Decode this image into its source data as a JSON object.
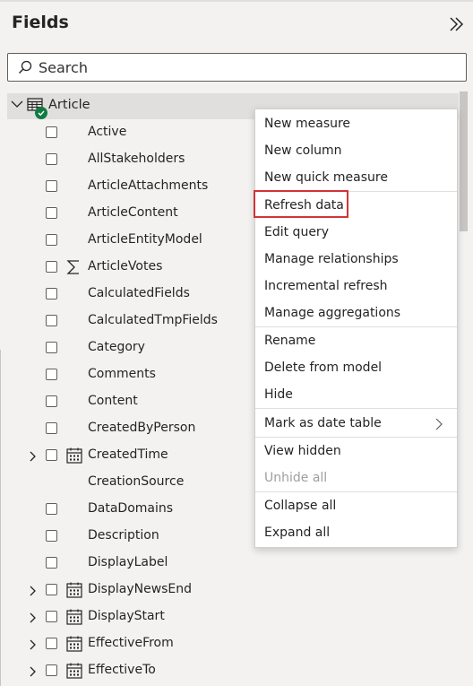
{
  "pane": {
    "title": "Fields",
    "collapse_icon": "double-chevron-right-icon"
  },
  "search": {
    "placeholder": "Search",
    "value": ""
  },
  "table": {
    "name": "Article",
    "expanded": true,
    "icon": "table-icon",
    "badge": "check-badge-icon"
  },
  "fields": [
    {
      "label": "Active",
      "icon": "",
      "expandable": false
    },
    {
      "label": "AllStakeholders",
      "icon": "",
      "expandable": false
    },
    {
      "label": "ArticleAttachments",
      "icon": "",
      "expandable": false
    },
    {
      "label": "ArticleContent",
      "icon": "",
      "expandable": false
    },
    {
      "label": "ArticleEntityModel",
      "icon": "",
      "expandable": false
    },
    {
      "label": "ArticleVotes",
      "icon": "sigma-icon",
      "expandable": false
    },
    {
      "label": "CalculatedFields",
      "icon": "",
      "expandable": false
    },
    {
      "label": "CalculatedTmpFields",
      "icon": "",
      "expandable": false
    },
    {
      "label": "Category",
      "icon": "",
      "expandable": false
    },
    {
      "label": "Comments",
      "icon": "",
      "expandable": false
    },
    {
      "label": "Content",
      "icon": "",
      "expandable": false
    },
    {
      "label": "CreatedByPerson",
      "icon": "",
      "expandable": false
    },
    {
      "label": "CreatedTime",
      "icon": "calendar-icon",
      "expandable": true
    },
    {
      "label": "CreationSource",
      "icon": "",
      "expandable": false
    },
    {
      "label": "DataDomains",
      "icon": "",
      "expandable": false
    },
    {
      "label": "Description",
      "icon": "",
      "expandable": false
    },
    {
      "label": "DisplayLabel",
      "icon": "",
      "expandable": false
    },
    {
      "label": "DisplayNewsEnd",
      "icon": "calendar-icon",
      "expandable": true
    },
    {
      "label": "DisplayStart",
      "icon": "calendar-icon",
      "expandable": true
    },
    {
      "label": "EffectiveFrom",
      "icon": "calendar-icon",
      "expandable": true
    },
    {
      "label": "EffectiveTo",
      "icon": "calendar-icon",
      "expandable": true
    }
  ],
  "context_menu": {
    "items": [
      {
        "label": "New measure"
      },
      {
        "label": "New column"
      },
      {
        "label": "New quick measure"
      },
      {
        "label": "Refresh data",
        "highlighted": true
      },
      {
        "label": "Edit query"
      },
      {
        "label": "Manage relationships"
      },
      {
        "label": "Incremental refresh"
      },
      {
        "label": "Manage aggregations"
      },
      {
        "label": "Rename"
      },
      {
        "label": "Delete from model"
      },
      {
        "label": "Hide"
      },
      {
        "label": "Mark as date table",
        "submenu": true
      },
      {
        "label": "View hidden"
      },
      {
        "label": "Unhide all",
        "disabled": true
      },
      {
        "label": "Collapse all"
      },
      {
        "label": "Expand all"
      }
    ]
  },
  "colors": {
    "highlight_border": "#d13438",
    "badge_green": "#107c41",
    "pane_background": "#f3f2f1"
  }
}
